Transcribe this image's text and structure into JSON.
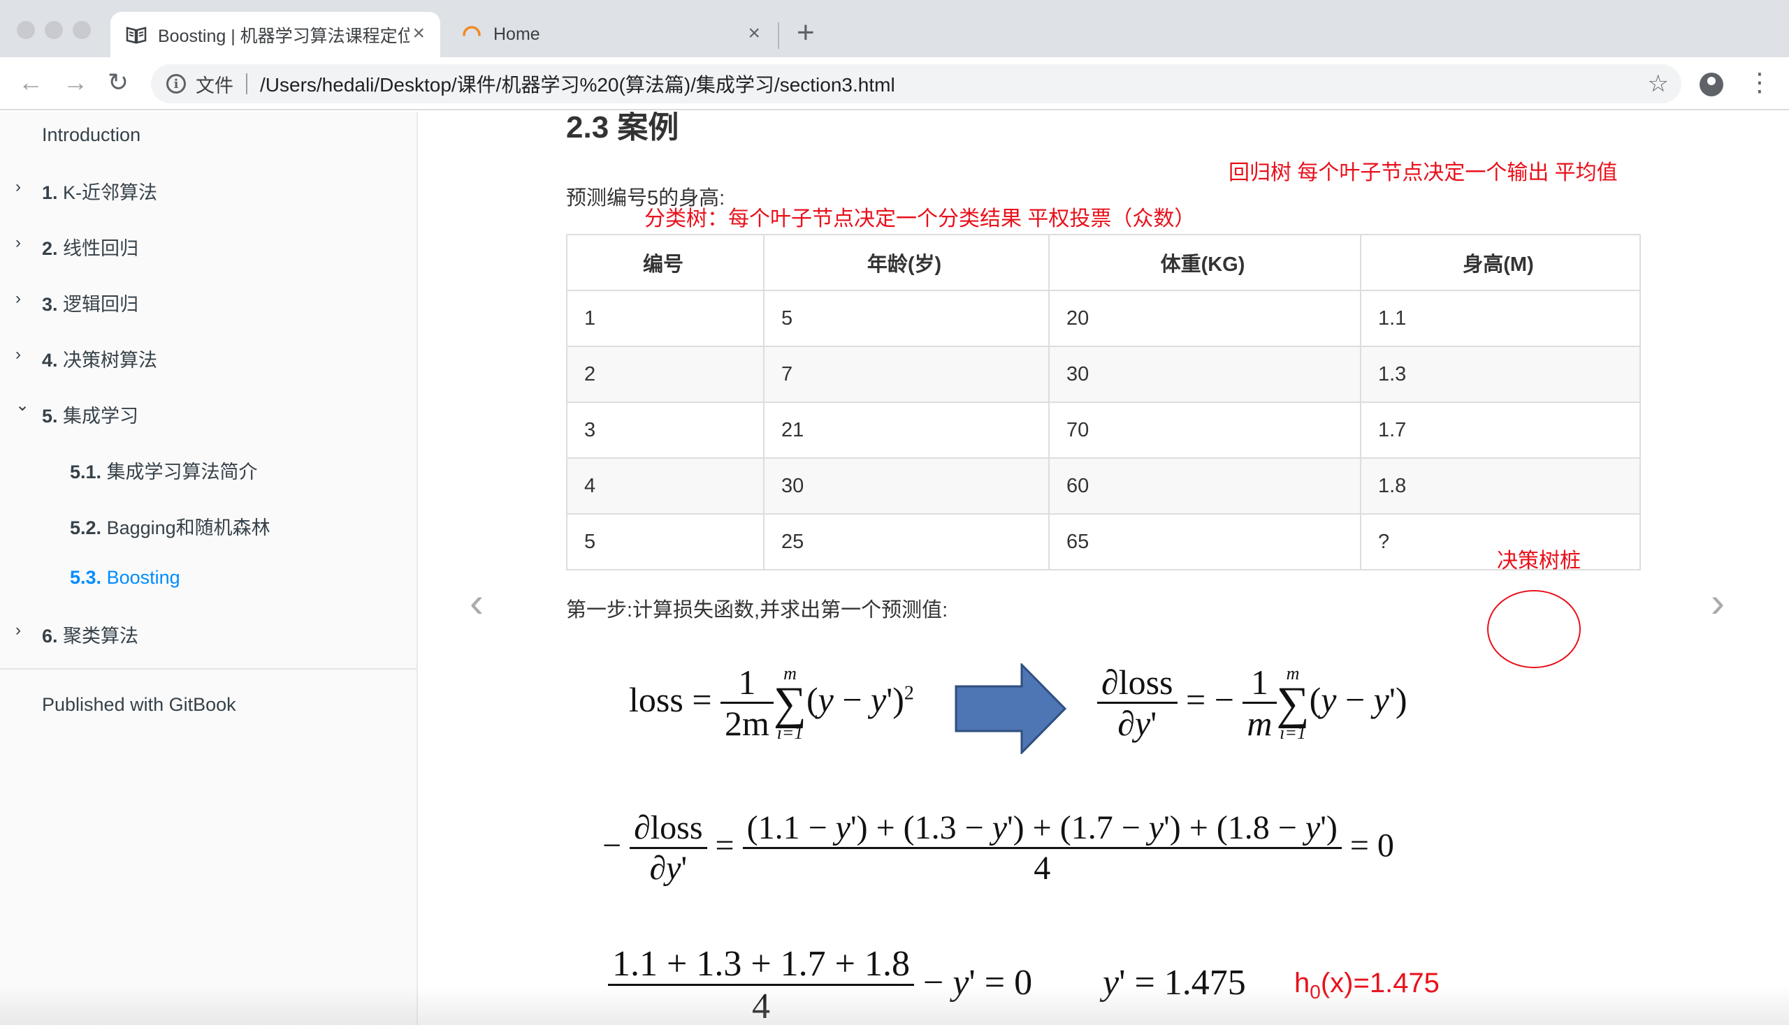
{
  "browser": {
    "tabs": [
      {
        "title": "Boosting | 机器学习算法课程定位、目标",
        "icon": "book-icon",
        "close": "×"
      },
      {
        "title": "Home",
        "icon": "loading-icon",
        "close": "×"
      }
    ],
    "new_tab": "+",
    "omnibox": {
      "scheme_label": "文件",
      "url": "/Users/hedali/Desktop/课件/机器学习%20(算法篇)/集成学习/section3.html"
    },
    "nav": {
      "back": "←",
      "forward": "→",
      "reload": "↻"
    },
    "star": "☆",
    "menu": "⋮"
  },
  "sidebar": {
    "intro": "Introduction",
    "items": [
      {
        "num": "1.",
        "label": "K-近邻算法",
        "chevron": "›"
      },
      {
        "num": "2.",
        "label": "线性回归",
        "chevron": "›"
      },
      {
        "num": "3.",
        "label": "逻辑回归",
        "chevron": "›"
      },
      {
        "num": "4.",
        "label": "决策树算法",
        "chevron": "›"
      },
      {
        "num": "5.",
        "label": "集成学习",
        "chevron": "⌄"
      },
      {
        "num": "6.",
        "label": "聚类算法",
        "chevron": "›"
      }
    ],
    "subitems": [
      {
        "num": "5.1.",
        "label": "集成学习算法简介"
      },
      {
        "num": "5.2.",
        "label": "Bagging和随机森林"
      },
      {
        "num": "5.3.",
        "label": "Boosting"
      }
    ],
    "footer": "Published with GitBook"
  },
  "content": {
    "heading": "2.3 案例",
    "intro": "预测编号5的身高:",
    "table": {
      "headers": [
        "编号",
        "年龄(岁)",
        "体重(KG)",
        "身高(M)"
      ],
      "rows": [
        [
          "1",
          "5",
          "20",
          "1.1"
        ],
        [
          "2",
          "7",
          "30",
          "1.3"
        ],
        [
          "3",
          "21",
          "70",
          "1.7"
        ],
        [
          "4",
          "30",
          "60",
          "1.8"
        ],
        [
          "5",
          "25",
          "65",
          "?"
        ]
      ]
    },
    "step1": "第一步:计算损失函数,并求出第一个预测值:",
    "annotations": {
      "regression": "回归树   每个叶子节点决定一个输出   平均值",
      "classification": "分类树：每个叶子节点决定一个分类结果   平权投票（众数）",
      "stump": "决策树桩",
      "h0": "h",
      "h0_sub": "0",
      "h0_rest": "(x)=1.475"
    },
    "nav_prev": "‹",
    "nav_next": "›",
    "colors": {
      "annotation": "#e8101b",
      "arrow": "#4e76b4",
      "link": "#008cff"
    }
  }
}
